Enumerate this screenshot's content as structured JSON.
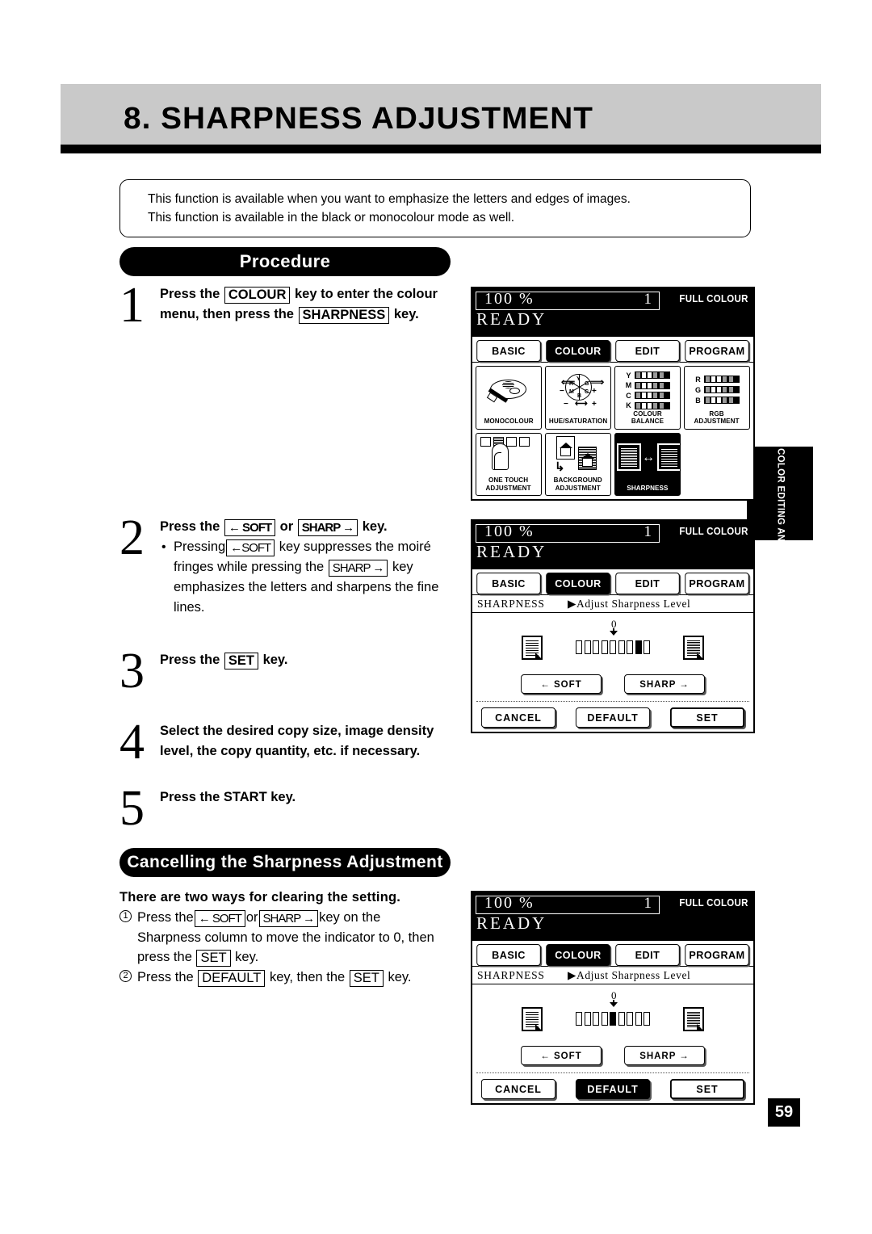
{
  "page": {
    "title": "8. SHARPNESS ADJUSTMENT",
    "number": "59",
    "side_tab": "COLOR EDITING AND ADJUSTMENT"
  },
  "intro": {
    "line1": "This function is available when you want to emphasize the letters and edges of images.",
    "line2": "This function is available in the black or monocolour mode as well."
  },
  "sections": {
    "procedure_heading": "Procedure",
    "cancel_heading": "Cancelling the Sharpness Adjustment"
  },
  "steps": [
    {
      "num": "1",
      "t1": "Press the",
      "k1": "COLOUR",
      "t2": "key to enter the colour",
      "t3": "menu, then press the",
      "k2": "SHARPNESS",
      "t4": "key."
    },
    {
      "num": "2",
      "t1": "Press the",
      "k1": "← SOFT",
      "t2": "or",
      "k2": "SHARP →",
      "t3": "key.",
      "b1": "Pressing",
      "bk1": "←SOFT",
      "b2": "key suppresses the moiré",
      "b3": "fringes while pressing the",
      "bk2": "SHARP →",
      "b4": "key",
      "b5": "emphasizes the letters and sharpens the fine",
      "b6": "lines."
    },
    {
      "num": "3",
      "t1": "Press the",
      "k1": "SET",
      "t2": "key."
    },
    {
      "num": "4",
      "t1": "Select the desired copy size, image density",
      "t2": "level, the copy quantity, etc. if necessary."
    },
    {
      "num": "5",
      "t1": "Press the START key."
    }
  ],
  "cancel": {
    "heading": "There are two ways for clearing the setting.",
    "item1": {
      "num": "1",
      "a": "Press the",
      "k1": "← SOFT",
      "b": "or",
      "k2": "SHARP →",
      "c": "key on the",
      "d": "Sharpness column to move the indicator to 0, then",
      "e": "press the",
      "k3": "SET",
      "f": "key."
    },
    "item2": {
      "num": "2",
      "a": "Press the",
      "k1": "DEFAULT",
      "b": "key, then the",
      "k2": "SET",
      "c": "key."
    }
  },
  "lcd": {
    "header": {
      "zoom": "100  %",
      "quantity": "1",
      "mode": "FULL COLOUR",
      "status": "READY"
    },
    "tabs": [
      {
        "label": "BASIC",
        "selected": false
      },
      {
        "label": "COLOUR",
        "selected": true
      },
      {
        "label": "EDIT",
        "selected": false
      },
      {
        "label": "PROGRAM",
        "selected": false
      }
    ],
    "functions": [
      {
        "label": "MONOCOLOUR",
        "icon": "palette-icon",
        "selected": false
      },
      {
        "label": "HUE/SATURATION",
        "icon": "colour-wheel-icon",
        "selected": false
      },
      {
        "label": "COLOUR BALANCE",
        "icon": "ymck-bars-icon",
        "selected": false
      },
      {
        "label": "RGB\nADJUSTMENT",
        "icon": "rgb-bars-icon",
        "selected": false
      },
      {
        "label": "ONE TOUCH\nADJUSTMENT",
        "icon": "finger-swatches-icon",
        "selected": false
      },
      {
        "label": "BACKGROUND\nADJUSTMENT",
        "icon": "two-pages-icon",
        "selected": false
      },
      {
        "label": "SHARPNESS",
        "icon": "sharpness-pages-icon",
        "selected": true
      }
    ],
    "colour_balance_channels": [
      "Y",
      "M",
      "C",
      "K"
    ],
    "rgb_channels": [
      "R",
      "G",
      "B"
    ],
    "rgb_label": "RGB\nADJUSTMENT",
    "sharpness_screen": {
      "title": "SHARPNESS",
      "prompt": "▶Adjust Sharpness Level",
      "zero_label": "0",
      "soft_button": "←  SOFT",
      "sharp_button": "SHARP →",
      "cancel_button": "CANCEL",
      "default_button": "DEFAULT",
      "set_button": "SET",
      "scale_steps": 9,
      "zero_index": 5
    },
    "screen2": {
      "active_index": 8,
      "default_selected": false
    },
    "screen3": {
      "active_index": 5,
      "default_selected": true
    }
  }
}
